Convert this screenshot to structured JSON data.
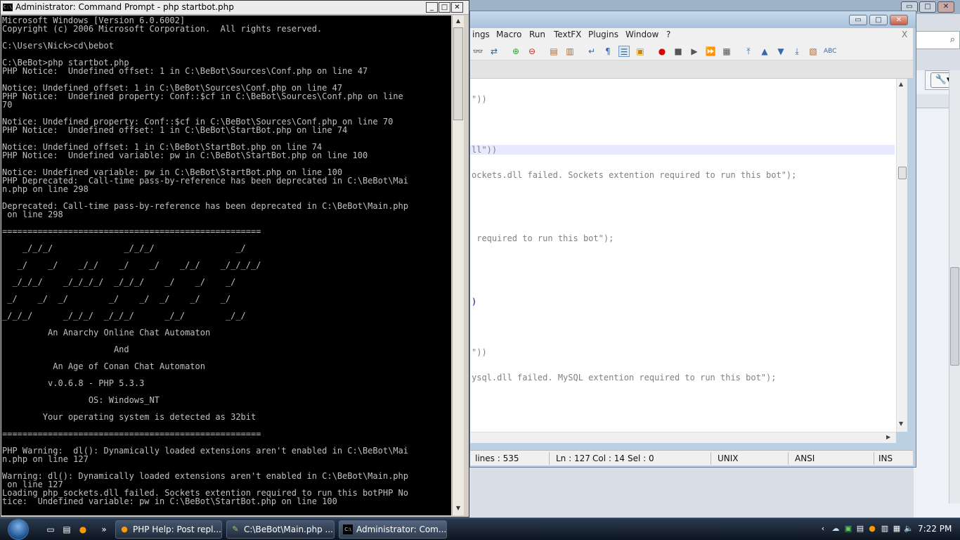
{
  "background_window": {
    "search_icon": "search-icon",
    "wrench_icon": "wrench-icon"
  },
  "cmd": {
    "title": "Administrator: Command Prompt - php  startbot.php",
    "buttons": {
      "minimize": "_",
      "maximize": "□",
      "close": "✕"
    },
    "output": "Microsoft Windows [Version 6.0.6002]\nCopyright (c) 2006 Microsoft Corporation.  All rights reserved.\n\nC:\\Users\\Nick>cd\\bebot\n\nC:\\BeBot>php startbot.php\nPHP Notice:  Undefined offset: 1 in C:\\BeBot\\Sources\\Conf.php on line 47\n\nNotice: Undefined offset: 1 in C:\\BeBot\\Sources\\Conf.php on line 47\nPHP Notice:  Undefined property: Conf::$cf in C:\\BeBot\\Sources\\Conf.php on line\n70\n\nNotice: Undefined property: Conf::$cf in C:\\BeBot\\Sources\\Conf.php on line 70\nPHP Notice:  Undefined offset: 1 in C:\\BeBot\\StartBot.php on line 74\n\nNotice: Undefined offset: 1 in C:\\BeBot\\StartBot.php on line 74\nPHP Notice:  Undefined variable: pw in C:\\BeBot\\StartBot.php on line 100\n\nNotice: Undefined variable: pw in C:\\BeBot\\StartBot.php on line 100\nPHP Deprecated:  Call-time pass-by-reference has been deprecated in C:\\BeBot\\Mai\nn.php on line 298\n\nDeprecated: Call-time pass-by-reference has been deprecated in C:\\BeBot\\Main.php\n on line 298\n\n===================================================\n\n    _/_/_/              _/_/_/                _/\n\n   _/    _/    _/_/    _/    _/    _/_/    _/_/_/_/\n\n  _/_/_/    _/_/_/_/  _/_/_/    _/    _/    _/\n\n _/    _/  _/        _/    _/  _/    _/    _/\n\n_/_/_/      _/_/_/  _/_/_/      _/_/        _/_/\n\n         An Anarchy Online Chat Automaton\n\n                      And\n\n          An Age of Conan Chat Automaton\n\n         v.0.6.8 - PHP 5.3.3\n\n                 OS: Windows_NT\n\n        Your operating system is detected as 32bit\n\n===================================================\n\nPHP Warning:  dl(): Dynamically loaded extensions aren't enabled in C:\\BeBot\\Mai\nn.php on line 127\n\nWarning: dl(): Dynamically loaded extensions aren't enabled in C:\\BeBot\\Main.php\n on line 127\nLoading php_sockets.dll failed. Sockets extention required to run this botPHP No\ntice:  Undefined variable: pw in C:\\BeBot\\StartBot.php on line 100"
  },
  "npp": {
    "menu": [
      "ings",
      "Macro",
      "Run",
      "TextFX",
      "Plugins",
      "Window",
      "?"
    ],
    "menu_close": "X",
    "window_buttons": {
      "minimize": "▭",
      "maximize": "□",
      "close": "✕"
    },
    "code_lines": [
      {
        "text": "\"))"
      },
      {
        "text": "ll\"))",
        "highlight": true
      },
      {
        "text": "ockets.dll failed. Sockets extention required to run this bot\");"
      },
      {
        "text": " required to run this bot\");"
      },
      {
        "text": ")"
      },
      {
        "text": "\"))"
      },
      {
        "text": "ysql.dll failed. MySQL extention required to run this bot\");"
      }
    ],
    "status": {
      "lines": "lines : 535",
      "ln": "Ln : 127",
      "col": "Col : 14",
      "sel": "Sel : 0",
      "eol": "UNIX",
      "encoding": "ANSI",
      "mode": "INS"
    }
  },
  "taskbar": {
    "tasks": [
      {
        "label": "PHP Help: Post repl...",
        "icon": "firefox-icon"
      },
      {
        "label": "C:\\BeBot\\Main.php ...",
        "icon": "notepadpp-icon"
      },
      {
        "label": "Administrator: Com...",
        "icon": "cmd-icon"
      }
    ],
    "clock": "7:22 PM",
    "quicklaunch_more": "»"
  }
}
